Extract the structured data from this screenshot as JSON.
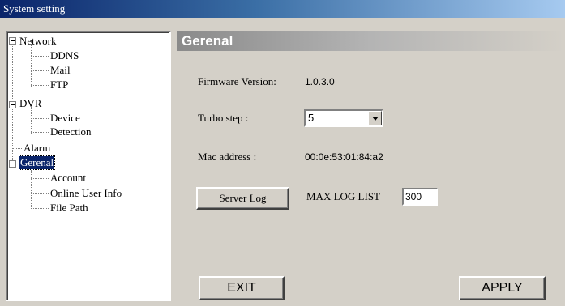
{
  "window": {
    "title": "System setting"
  },
  "tree": {
    "network": "Network",
    "ddns": "DDNS",
    "mail": "Mail",
    "ftp": "FTP",
    "dvr": "DVR",
    "device": "Device",
    "detection": "Detection",
    "alarm": "Alarm",
    "gerenal": "Gerenal",
    "account": "Account",
    "online_user_info": "Online User Info",
    "file_path": "File Path"
  },
  "panel": {
    "header": "Gerenal",
    "firmware_label": "Firmware Version:",
    "firmware_value": "1.0.3.0",
    "turbo_label": "Turbo step :",
    "turbo_value": "5",
    "mac_label": "Mac address :",
    "mac_value": "00:0e:53:01:84:a2",
    "server_log_button": "Server Log",
    "max_log_label": "MAX LOG LIST",
    "max_log_value": "300",
    "exit_button": "EXIT",
    "apply_button": "APPLY"
  }
}
